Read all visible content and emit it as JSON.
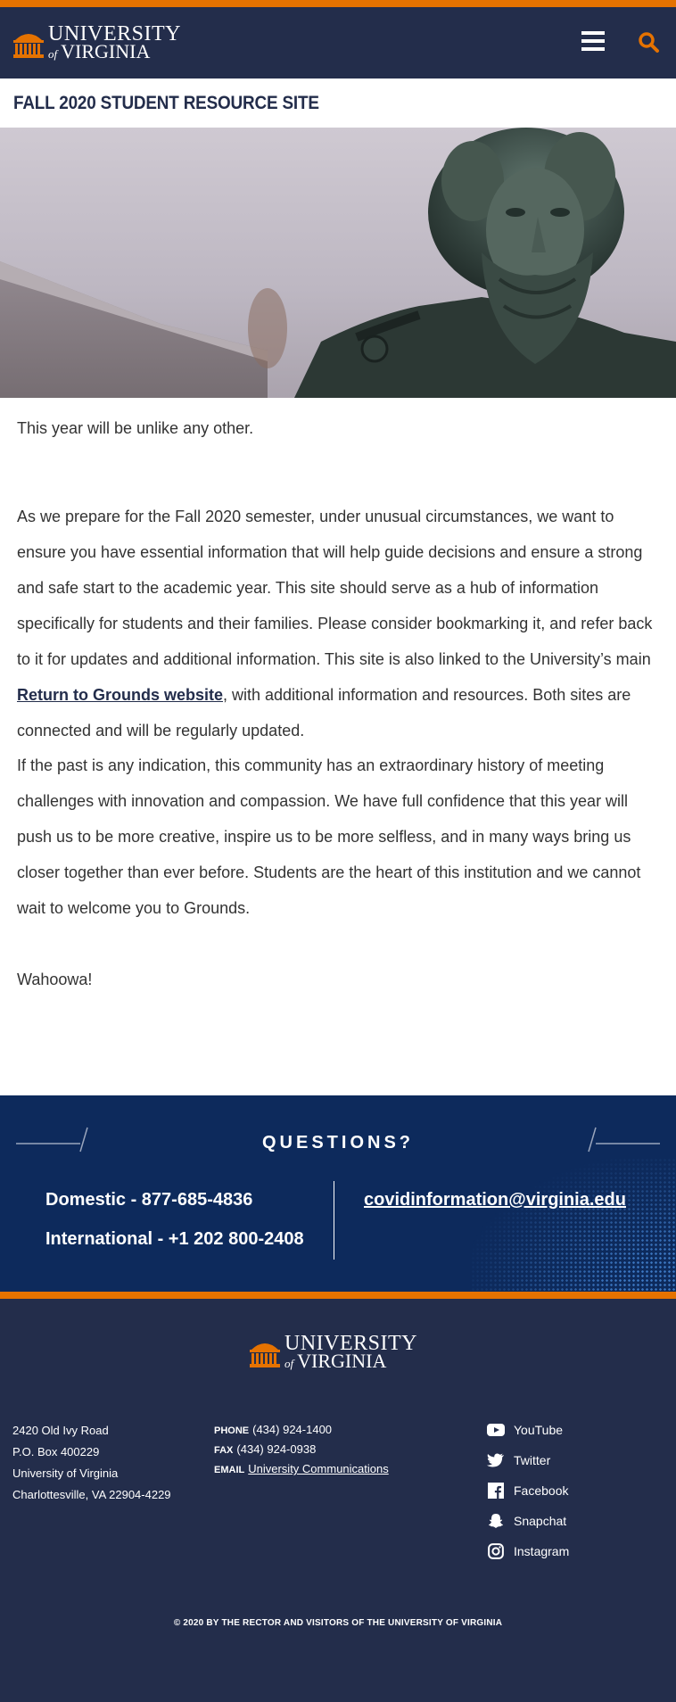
{
  "header": {
    "logo_line1": "UNIVERSITY",
    "logo_of": "of",
    "logo_line2": "VIRGINIA",
    "menu_icon": "hamburger-menu-icon",
    "search_icon": "search-icon"
  },
  "site_title": "FALL 2020 STUDENT RESOURCE SITE",
  "content": {
    "intro": "This year will be unlike any other.",
    "para1_before_link": "As we prepare for the Fall 2020 semester, under unusual circumstances, we want to ensure you have essential information that will help guide decisions and ensure a strong and safe start to the academic year. This site should serve as a hub of information specifically for students and their families. Please consider bookmarking it, and refer back to it for updates and additional information. This site is also linked to the University’s main ",
    "para1_link": "Return to Grounds website",
    "para1_after_link": ", with additional information and resources. Both sites are connected and will be regularly updated.",
    "para2": "If the past is any indication, this community has an extraordinary history of meeting challenges with innovation and compassion. We have full confidence that this year will push us to be more creative, inspire us to be more selfless, and in many ways bring us closer together than ever before. Students are the heart of this institution and we cannot wait to welcome you to Grounds.",
    "closing": "Wahoowa!"
  },
  "questions": {
    "title": "QUESTIONS?",
    "domestic": "Domestic - 877-685-4836",
    "international": "International - +1 202 800-2408",
    "email": "covidinformation@virginia.edu"
  },
  "footer": {
    "address": [
      "2420 Old Ivy Road",
      "P.O. Box 400229",
      "University of Virginia",
      "Charlottesville, VA 22904-4229"
    ],
    "phone_label": "PHONE",
    "phone": "(434) 924-1400",
    "fax_label": "FAX",
    "fax": "(434) 924-0938",
    "email_label": "EMAIL",
    "email_link": "University Communications",
    "social": [
      {
        "label": "YouTube",
        "icon": "youtube-icon"
      },
      {
        "label": "Twitter",
        "icon": "twitter-icon"
      },
      {
        "label": "Facebook",
        "icon": "facebook-icon"
      },
      {
        "label": "Snapchat",
        "icon": "snapchat-icon"
      },
      {
        "label": "Instagram",
        "icon": "instagram-icon"
      }
    ],
    "copyright": "© 2020 BY THE RECTOR AND VISITORS OF THE UNIVERSITY OF VIRGINIA"
  },
  "colors": {
    "navy": "#232d4b",
    "orange": "#e57200",
    "questions_blue": "#0d2a5c"
  }
}
